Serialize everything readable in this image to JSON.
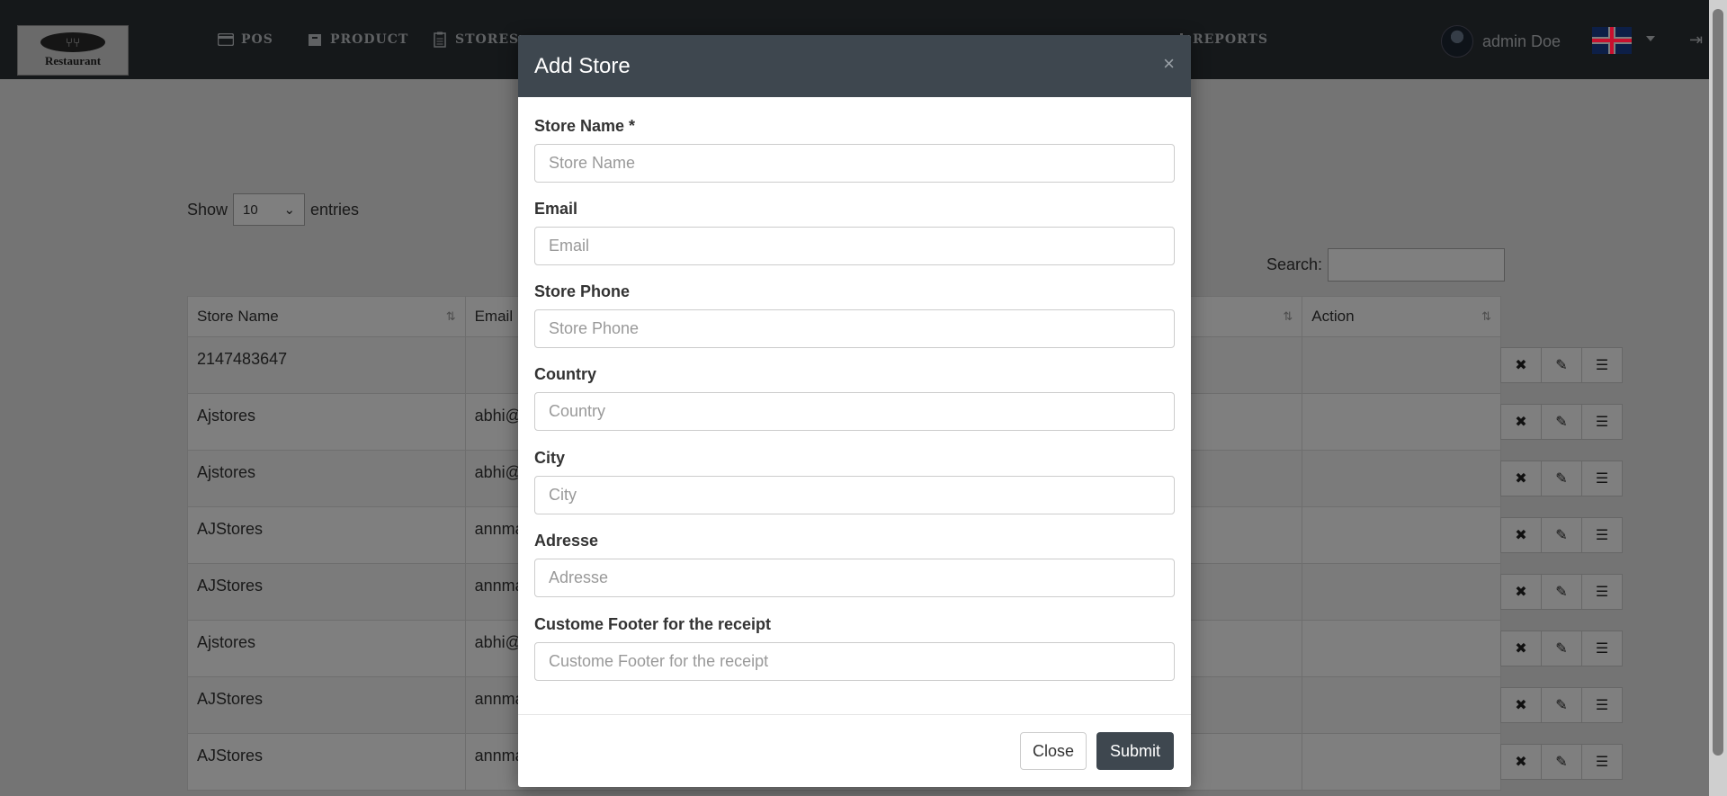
{
  "navbar": {
    "logo_text": "Restaurant",
    "items": [
      {
        "label": "POS",
        "icon": "credit-card-icon"
      },
      {
        "label": "PRODUCT",
        "icon": "archive-icon"
      },
      {
        "label": "STORES",
        "icon": "clipboard-icon"
      },
      {
        "label": "REPORTS",
        "icon": "chart-icon"
      }
    ],
    "user_name": "admin Doe",
    "language": "English (UK flag)"
  },
  "table_controls": {
    "show_label": "Show",
    "entries_value": "10",
    "entries_label": "entries",
    "search_label": "Search:"
  },
  "table": {
    "columns": [
      "Store Name",
      "Email",
      "Action"
    ],
    "rows": [
      {
        "name": "2147483647",
        "email": ""
      },
      {
        "name": "Ajstores",
        "email": "abhi@"
      },
      {
        "name": "Ajstores",
        "email": "abhi@"
      },
      {
        "name": "AJStores",
        "email": "annma"
      },
      {
        "name": "AJStores",
        "email": "annma"
      },
      {
        "name": "Ajstores",
        "email": "abhi@"
      },
      {
        "name": "AJStores",
        "email": "annma"
      },
      {
        "name": "AJStores",
        "email": "annma"
      }
    ]
  },
  "modal": {
    "title": "Add Store",
    "close_x": "×",
    "fields": [
      {
        "label": "Store Name *",
        "placeholder": "Store Name"
      },
      {
        "label": "Email",
        "placeholder": "Email"
      },
      {
        "label": "Store Phone",
        "placeholder": "Store Phone"
      },
      {
        "label": "Country",
        "placeholder": "Country"
      },
      {
        "label": "City",
        "placeholder": "City"
      },
      {
        "label": "Adresse",
        "placeholder": "Adresse"
      },
      {
        "label": "Custome Footer for the receipt",
        "placeholder": "Custome Footer for the receipt"
      }
    ],
    "close_label": "Close",
    "submit_label": "Submit"
  },
  "colors": {
    "navbar_bg": "#2b3035",
    "modal_header_bg": "#3e474f",
    "submit_bg": "#3e474f"
  }
}
